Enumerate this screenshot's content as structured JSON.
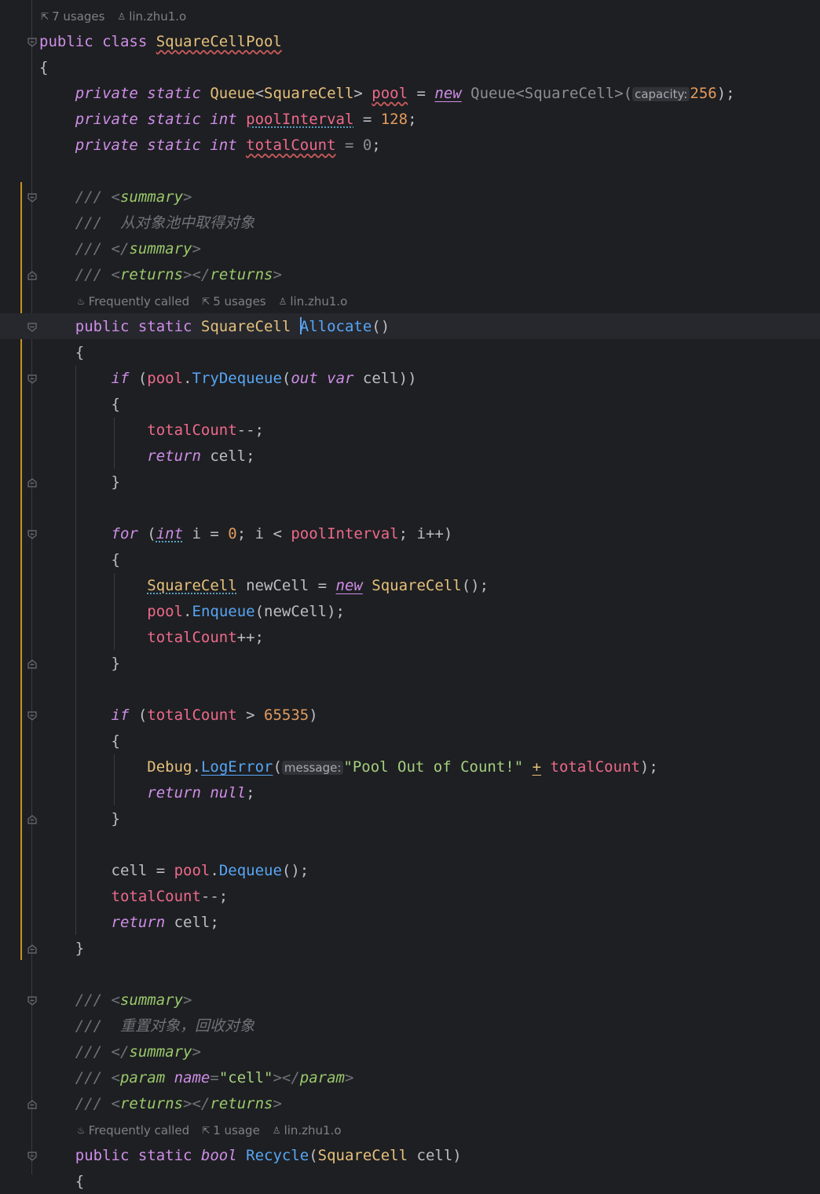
{
  "lines": [
    {
      "type": "meta",
      "indent": 0,
      "items": [
        {
          "icon": "usages-icon",
          "text": "7 usages"
        },
        {
          "icon": "user-icon",
          "text": "lin.zhu1.o"
        }
      ]
    },
    {
      "type": "code",
      "fold": "open",
      "tokens": [
        [
          "kwp",
          "public "
        ],
        [
          "kwp",
          "class "
        ],
        [
          "cls sq",
          "SquareCellPool"
        ]
      ]
    },
    {
      "type": "code",
      "tokens": [
        [
          "",
          "{"
        ]
      ]
    },
    {
      "type": "code",
      "tokens": [
        [
          "",
          "    "
        ],
        [
          "kw",
          "private "
        ],
        [
          "kw",
          "static "
        ],
        [
          "cls",
          "Queue"
        ],
        [
          "",
          "<"
        ],
        [
          "cls",
          "SquareCell"
        ],
        [
          "",
          "> "
        ],
        [
          "fld sq",
          "pool"
        ],
        [
          "",
          " = "
        ],
        [
          "kw ul",
          "new"
        ],
        [
          "",
          " "
        ],
        [
          "dim",
          "Queue<SquareCell>("
        ],
        [
          "hint",
          "capacity:"
        ],
        [
          "num",
          "256"
        ],
        [
          "",
          ");"
        ]
      ]
    },
    {
      "type": "code",
      "tokens": [
        [
          "",
          "    "
        ],
        [
          "kw",
          "private "
        ],
        [
          "kw",
          "static "
        ],
        [
          "kw",
          "int "
        ],
        [
          "fld dot",
          "poolInterval"
        ],
        [
          "",
          " = "
        ],
        [
          "num",
          "128"
        ],
        [
          "",
          ";"
        ]
      ]
    },
    {
      "type": "code",
      "tokens": [
        [
          "",
          "    "
        ],
        [
          "kw",
          "private "
        ],
        [
          "kw",
          "static "
        ],
        [
          "kw",
          "int "
        ],
        [
          "fld sq",
          "totalCount"
        ],
        [
          "dim",
          " = "
        ],
        [
          "dim",
          "0"
        ],
        [
          "",
          ";"
        ]
      ]
    },
    {
      "type": "blank"
    },
    {
      "type": "code",
      "fold": "open",
      "tokens": [
        [
          "",
          "    "
        ],
        [
          "com",
          "/// <"
        ],
        [
          "tag",
          "summary"
        ],
        [
          "com",
          ">"
        ]
      ]
    },
    {
      "type": "code",
      "tokens": [
        [
          "",
          "    "
        ],
        [
          "com",
          "///  从对象池中取得对象"
        ]
      ]
    },
    {
      "type": "code",
      "tokens": [
        [
          "",
          "    "
        ],
        [
          "com",
          "/// </"
        ],
        [
          "tag",
          "summary"
        ],
        [
          "com",
          ">"
        ]
      ]
    },
    {
      "type": "code",
      "fold": "close",
      "tokens": [
        [
          "",
          "    "
        ],
        [
          "com",
          "/// <"
        ],
        [
          "tag",
          "returns"
        ],
        [
          "com",
          "></"
        ],
        [
          "tag",
          "returns"
        ],
        [
          "com",
          ">"
        ]
      ]
    },
    {
      "type": "meta",
      "indent": 4,
      "items": [
        {
          "icon": "fire-icon",
          "text": "Frequently called"
        },
        {
          "icon": "usages-icon",
          "text": "5 usages"
        },
        {
          "icon": "user-icon",
          "text": "lin.zhu1.o"
        }
      ]
    },
    {
      "type": "code",
      "fold": "open",
      "current": true,
      "tokens": [
        [
          "",
          "    "
        ],
        [
          "kwp",
          "public "
        ],
        [
          "kwp",
          "static "
        ],
        [
          "cls",
          "SquareCell "
        ],
        [
          "caret",
          ""
        ],
        [
          "mth",
          "Allocate"
        ],
        [
          "",
          "()"
        ]
      ]
    },
    {
      "type": "code",
      "tokens": [
        [
          "",
          "    {"
        ]
      ]
    },
    {
      "type": "code",
      "fold": "open",
      "tokens": [
        [
          "",
          "        "
        ],
        [
          "kw",
          "if "
        ],
        [
          "",
          "("
        ],
        [
          "fld",
          "pool"
        ],
        [
          "",
          "."
        ],
        [
          "mth",
          "TryDequeue"
        ],
        [
          "",
          "("
        ],
        [
          "kw",
          "out "
        ],
        [
          "kw",
          "var "
        ],
        [
          "",
          "cell))"
        ]
      ]
    },
    {
      "type": "code",
      "tokens": [
        [
          "",
          "        {"
        ]
      ]
    },
    {
      "type": "code",
      "tokens": [
        [
          "",
          "            "
        ],
        [
          "fld",
          "totalCount"
        ],
        [
          "",
          "--;"
        ]
      ]
    },
    {
      "type": "code",
      "tokens": [
        [
          "",
          "            "
        ],
        [
          "kw",
          "return "
        ],
        [
          "",
          "cell;"
        ]
      ]
    },
    {
      "type": "code",
      "fold": "close",
      "tokens": [
        [
          "",
          "        }"
        ]
      ]
    },
    {
      "type": "blank"
    },
    {
      "type": "code",
      "fold": "open",
      "tokens": [
        [
          "",
          "        "
        ],
        [
          "kw",
          "for "
        ],
        [
          "",
          "("
        ],
        [
          "kw dot",
          "int"
        ],
        [
          "",
          " i = "
        ],
        [
          "num",
          "0"
        ],
        [
          "",
          "; i < "
        ],
        [
          "fld",
          "poolInterval"
        ],
        [
          "",
          "; i++)"
        ]
      ]
    },
    {
      "type": "code",
      "tokens": [
        [
          "",
          "        {"
        ]
      ]
    },
    {
      "type": "code",
      "tokens": [
        [
          "",
          "            "
        ],
        [
          "cls dot",
          "SquareCell"
        ],
        [
          "",
          " newCell = "
        ],
        [
          "kw ul",
          "new"
        ],
        [
          "",
          " "
        ],
        [
          "cls",
          "SquareCell"
        ],
        [
          "",
          "();"
        ]
      ]
    },
    {
      "type": "code",
      "tokens": [
        [
          "",
          "            "
        ],
        [
          "fld",
          "pool"
        ],
        [
          "",
          "."
        ],
        [
          "mth",
          "Enqueue"
        ],
        [
          "",
          "(newCell);"
        ]
      ]
    },
    {
      "type": "code",
      "tokens": [
        [
          "",
          "            "
        ],
        [
          "fld",
          "totalCount"
        ],
        [
          "",
          "++;"
        ]
      ]
    },
    {
      "type": "code",
      "fold": "close",
      "tokens": [
        [
          "",
          "        }"
        ]
      ]
    },
    {
      "type": "blank"
    },
    {
      "type": "code",
      "fold": "open",
      "tokens": [
        [
          "",
          "        "
        ],
        [
          "kw",
          "if "
        ],
        [
          "",
          "("
        ],
        [
          "fld",
          "totalCount"
        ],
        [
          "",
          " > "
        ],
        [
          "num",
          "65535"
        ],
        [
          "",
          ")"
        ]
      ]
    },
    {
      "type": "code",
      "tokens": [
        [
          "",
          "        {"
        ]
      ]
    },
    {
      "type": "code",
      "tokens": [
        [
          "",
          "            "
        ],
        [
          "cls",
          "Debug"
        ],
        [
          "",
          "."
        ],
        [
          "mth ul",
          "LogError"
        ],
        [
          "",
          "("
        ],
        [
          "hint",
          "message:"
        ],
        [
          "str",
          "\"Pool Out of Count!\""
        ],
        [
          "",
          " "
        ],
        [
          "cls ul",
          "+"
        ],
        [
          "",
          " "
        ],
        [
          "fld",
          "totalCount"
        ],
        [
          "",
          ");"
        ]
      ]
    },
    {
      "type": "code",
      "tokens": [
        [
          "",
          "            "
        ],
        [
          "kw",
          "return "
        ],
        [
          "kw",
          "null"
        ],
        [
          "",
          ";"
        ]
      ]
    },
    {
      "type": "code",
      "fold": "close",
      "tokens": [
        [
          "",
          "        }"
        ]
      ]
    },
    {
      "type": "blank"
    },
    {
      "type": "code",
      "tokens": [
        [
          "",
          "        cell = "
        ],
        [
          "fld",
          "pool"
        ],
        [
          "",
          "."
        ],
        [
          "mth",
          "Dequeue"
        ],
        [
          "",
          "();"
        ]
      ]
    },
    {
      "type": "code",
      "tokens": [
        [
          "",
          "        "
        ],
        [
          "fld",
          "totalCount"
        ],
        [
          "",
          "--;"
        ]
      ]
    },
    {
      "type": "code",
      "tokens": [
        [
          "",
          "        "
        ],
        [
          "kw",
          "return "
        ],
        [
          "",
          "cell;"
        ]
      ]
    },
    {
      "type": "code",
      "fold": "close",
      "tokens": [
        [
          "",
          "    }"
        ]
      ]
    },
    {
      "type": "blank"
    },
    {
      "type": "code",
      "fold": "open",
      "tokens": [
        [
          "",
          "    "
        ],
        [
          "com",
          "/// <"
        ],
        [
          "tag",
          "summary"
        ],
        [
          "com",
          ">"
        ]
      ]
    },
    {
      "type": "code",
      "tokens": [
        [
          "",
          "    "
        ],
        [
          "com",
          "///  重置对象，回收对象"
        ]
      ]
    },
    {
      "type": "code",
      "tokens": [
        [
          "",
          "    "
        ],
        [
          "com",
          "/// </"
        ],
        [
          "tag",
          "summary"
        ],
        [
          "com",
          ">"
        ]
      ]
    },
    {
      "type": "code",
      "tokens": [
        [
          "",
          "    "
        ],
        [
          "com",
          "/// <"
        ],
        [
          "tag",
          "param "
        ],
        [
          "attr",
          "name"
        ],
        [
          "com",
          "="
        ],
        [
          "str",
          "\"cell\""
        ],
        [
          "com",
          "></"
        ],
        [
          "tag",
          "param"
        ],
        [
          "com",
          ">"
        ]
      ]
    },
    {
      "type": "code",
      "fold": "close",
      "tokens": [
        [
          "",
          "    "
        ],
        [
          "com",
          "/// <"
        ],
        [
          "tag",
          "returns"
        ],
        [
          "com",
          "></"
        ],
        [
          "tag",
          "returns"
        ],
        [
          "com",
          ">"
        ]
      ]
    },
    {
      "type": "meta",
      "indent": 4,
      "items": [
        {
          "icon": "fire-icon",
          "text": "Frequently called"
        },
        {
          "icon": "usages-icon",
          "text": "1 usage"
        },
        {
          "icon": "user-icon",
          "text": "lin.zhu1.o"
        }
      ]
    },
    {
      "type": "code",
      "fold": "open",
      "tokens": [
        [
          "",
          "    "
        ],
        [
          "kwp",
          "public "
        ],
        [
          "kwp",
          "static "
        ],
        [
          "kw",
          "bool "
        ],
        [
          "mth",
          "Recycle"
        ],
        [
          "",
          "("
        ],
        [
          "cls",
          "SquareCell "
        ],
        [
          "",
          "cell)"
        ]
      ]
    },
    {
      "type": "code",
      "tokens": [
        [
          "",
          "    {"
        ]
      ]
    }
  ]
}
